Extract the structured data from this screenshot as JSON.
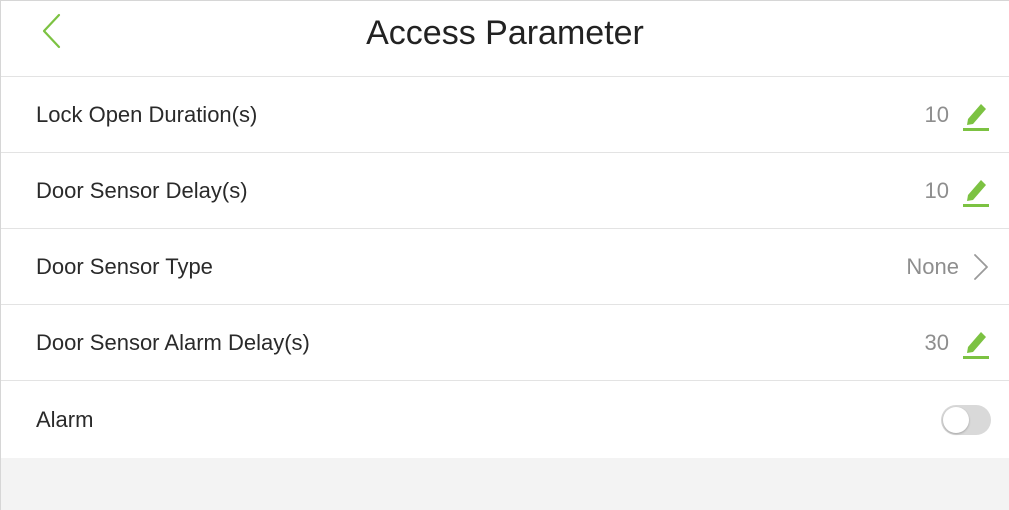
{
  "header": {
    "title": "Access Parameter"
  },
  "rows": [
    {
      "label": "Lock Open Duration(s)",
      "value": "10",
      "action_icon": "pencil-edit-icon"
    },
    {
      "label": "Door Sensor Delay(s)",
      "value": "10",
      "action_icon": "pencil-edit-icon"
    },
    {
      "label": "Door Sensor Type",
      "value": "None",
      "action_icon": "chevron-right-icon"
    },
    {
      "label": "Door Sensor Alarm Delay(s)",
      "value": "30",
      "action_icon": "pencil-edit-icon"
    },
    {
      "label": "Alarm",
      "toggle_on": false
    }
  ],
  "colors": {
    "accent": "#7cc242",
    "value_text": "#8e8e8e",
    "label_text": "#2a2a2a",
    "toggle_off": "#d9d9d9",
    "footer_bg": "#f3f3f3"
  }
}
